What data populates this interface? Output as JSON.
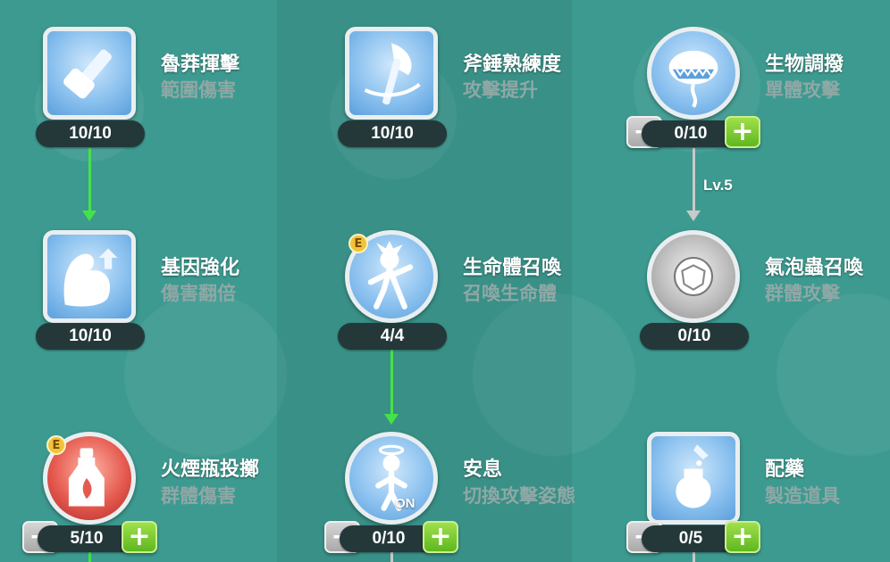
{
  "skills": [
    {
      "name": "魯莽揮擊",
      "desc": "範圍傷害",
      "level": "10/10",
      "icon": "hammer-icon"
    },
    {
      "name": "斧錘熟練度",
      "desc": "攻擊提升",
      "level": "10/10",
      "icon": "axe-icon"
    },
    {
      "name": "生物調撥",
      "desc": "單體攻擊",
      "level": "0/10",
      "icon": "plant-monster-icon"
    },
    {
      "name": "基因強化",
      "desc": "傷害翻倍",
      "level": "10/10",
      "icon": "muscle-arm-icon"
    },
    {
      "name": "生命體召喚",
      "desc": "召喚生命體",
      "level": "4/4",
      "icon": "homunculus-icon",
      "badge": "E"
    },
    {
      "name": "氣泡蟲召喚",
      "desc": "群體攻擊",
      "level": "0/10",
      "icon": "bubble-bug-icon"
    },
    {
      "name": "火煙瓶投擲",
      "desc": "群體傷害",
      "level": "5/10",
      "icon": "fire-bottle-icon",
      "badge": "E"
    },
    {
      "name": "安息",
      "desc": "切換攻擊姿態",
      "level": "0/10",
      "icon": "rest-angel-icon",
      "toggle": "ON"
    },
    {
      "name": "配藥",
      "desc": "製造道具",
      "level": "0/5",
      "icon": "potion-flask-icon"
    }
  ],
  "requirement": "Lv.5",
  "buttons": {
    "minus": "−",
    "plus": "+"
  },
  "colors": {
    "background": "#3d9a90",
    "link_active": "#44e247",
    "link_locked": "#c9c9c9",
    "badge": "#f0c33a"
  }
}
